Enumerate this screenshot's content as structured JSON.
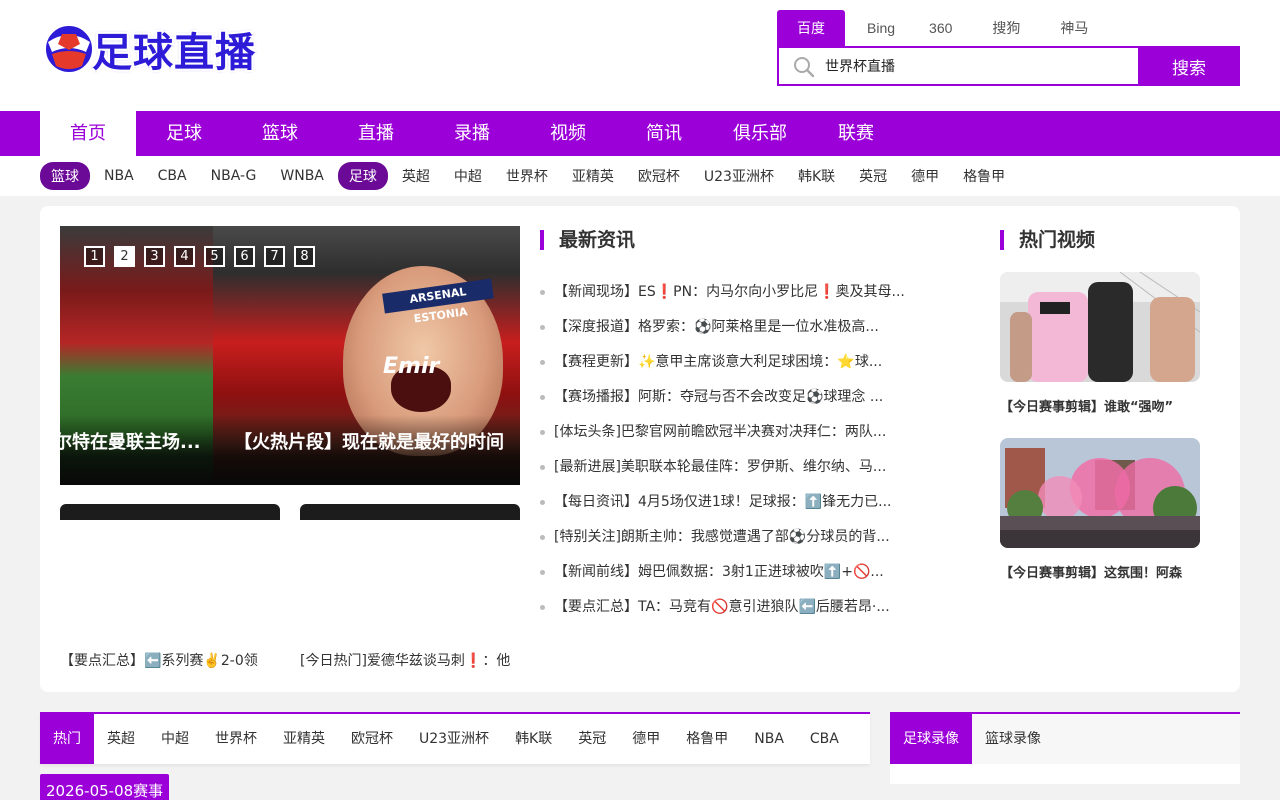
{
  "logo": {
    "text": "足球直播"
  },
  "search": {
    "engines": [
      "百度",
      "Bing",
      "360",
      "搜狗",
      "神马"
    ],
    "value": "世界杯直播",
    "button": "搜索"
  },
  "mainnav": [
    "首页",
    "足球",
    "篮球",
    "直播",
    "录播",
    "视频",
    "简讯",
    "俱乐部",
    "联赛"
  ],
  "subnav": {
    "basketball_label": "篮球",
    "basketball": [
      "NBA",
      "CBA",
      "NBA-G",
      "WNBA"
    ],
    "football_label": "足球",
    "football": [
      "英超",
      "中超",
      "世界杯",
      "亚精英",
      "欧冠杯",
      "U23亚洲杯",
      "韩K联",
      "英冠",
      "德甲",
      "格鲁甲"
    ]
  },
  "slider": {
    "dots": [
      "1",
      "2",
      "3",
      "4",
      "5",
      "6",
      "7",
      "8"
    ],
    "caption_left": "尔特在曼联主场...",
    "caption_right": "【火热片段】现在就是最好的时间",
    "sign_text": "ARSENAL ESTONIA",
    "shirt_text": "Emir",
    "thumb_left": "【要点汇总】⬅️系列赛✌️2-0领",
    "thumb_right": "[今日热门]爱德华兹谈马刺❗：他"
  },
  "news": {
    "title": "最新资讯",
    "items": [
      "【新闻现场】ES❗PN：内马尔向小罗比尼❗奥及其母...",
      "【深度报道】格罗索：⚽阿莱格里是一位水准极高...",
      "【赛程更新】✨意甲主席谈意大利足球困境：⭐球...",
      "【赛场播报】阿斯：夺冠与否不会改变足⚽球理念 ...",
      "[体坛头条]巴黎官网前瞻欧冠半决赛对决拜仁：两队...",
      "[最新进展]美职联本轮最佳阵：罗伊斯、维尔纳、马...",
      "【每日资讯】4月5场仅进1球！足球报：⬆️锋无力已...",
      "[特别关注]朗斯主帅：我感觉遭遇了部⚽分球员的背...",
      "【新闻前线】姆巴佩数据：3射1正进球被吹⬆️+🚫...",
      "【要点汇总】TA：马竞有🚫意引进狼队⬅️后腰若昂·..."
    ]
  },
  "videos": {
    "title": "热门视频",
    "items": [
      {
        "caption": "【今日赛事剪辑】谁敢“强吻”"
      },
      {
        "caption": "【今日赛事剪辑】这氛围！阿森"
      }
    ]
  },
  "bottom_tabs": [
    "热门",
    "英超",
    "中超",
    "世界杯",
    "亚精英",
    "欧冠杯",
    "U23亚洲杯",
    "韩K联",
    "英冠",
    "德甲",
    "格鲁甲",
    "NBA",
    "CBA"
  ],
  "right_tabs": [
    "足球录像",
    "篮球录像"
  ],
  "date_tag": "2026-05-08赛事",
  "colors": {
    "brand": "#9c00d9",
    "pill": "#6a0a96",
    "logo_text": "#2d1bd8"
  }
}
